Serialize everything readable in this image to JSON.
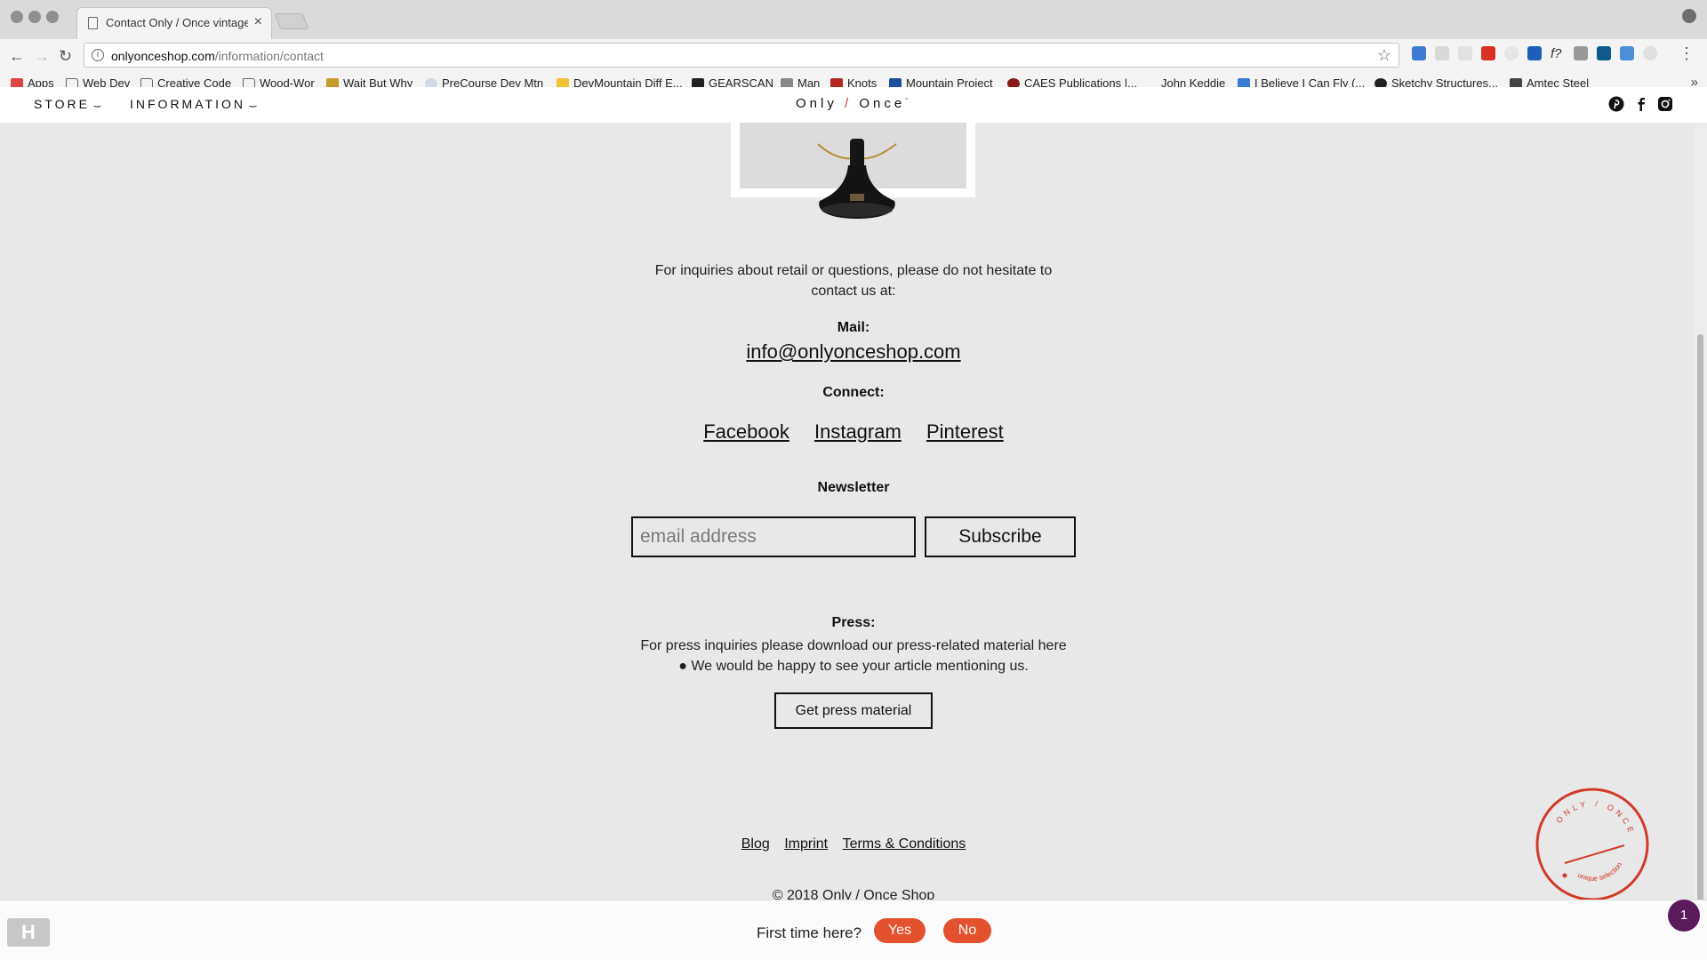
{
  "browser": {
    "tab_title": "Contact Only / Once vintage d",
    "url_host": "onlyonceshop.com",
    "url_path": "/information/contact",
    "bookmarks": [
      "Apps",
      "Web Dev",
      "Creative Code",
      "Wood-Wor",
      "Wait But Why",
      "PreCourse Dev Mtn",
      "DevMountain Diff E...",
      "GEARSCAN",
      "Man",
      "Knots",
      "Mountain Project",
      "CAES Publications |...",
      "John Keddie",
      "I Believe I Can Fly (...",
      "Sketchy Structures...",
      "Amtec Steel"
    ]
  },
  "header": {
    "nav": [
      "STORE",
      "INFORMATION"
    ],
    "brand_left": "Only",
    "brand_slash": "/",
    "brand_right": "Once"
  },
  "contact": {
    "intro_line1": "For inquiries about retail or questions, please do not hesitate to",
    "intro_line2": "contact us at:",
    "mail_label": "Mail:",
    "email": "info@onlyonceshop.com",
    "connect_label": "Connect:",
    "social_links": [
      "Facebook",
      "Instagram",
      "Pinterest"
    ],
    "newsletter_label": "Newsletter",
    "email_placeholder": "email address",
    "subscribe_label": "Subscribe",
    "press_label": "Press:",
    "press_line1": "For press inquiries please download our press-related material here",
    "press_line2": "● We would be happy to see your article mentioning us.",
    "press_button": "Get press material"
  },
  "footer": {
    "links": [
      "Blog",
      "Imprint",
      "Terms & Conditions"
    ],
    "copyright": "© 2018 Only / Once Shop"
  },
  "stamp": {
    "top_text": "ONLY / ONCE",
    "bottom_text": "unique selection",
    "color": "#d13a2a"
  },
  "first_time": {
    "question": "First time here?",
    "yes": "Yes",
    "no": "No",
    "accent": "#e4512f"
  },
  "chat": {
    "badge_count": "1",
    "color": "#5b1b5c"
  }
}
